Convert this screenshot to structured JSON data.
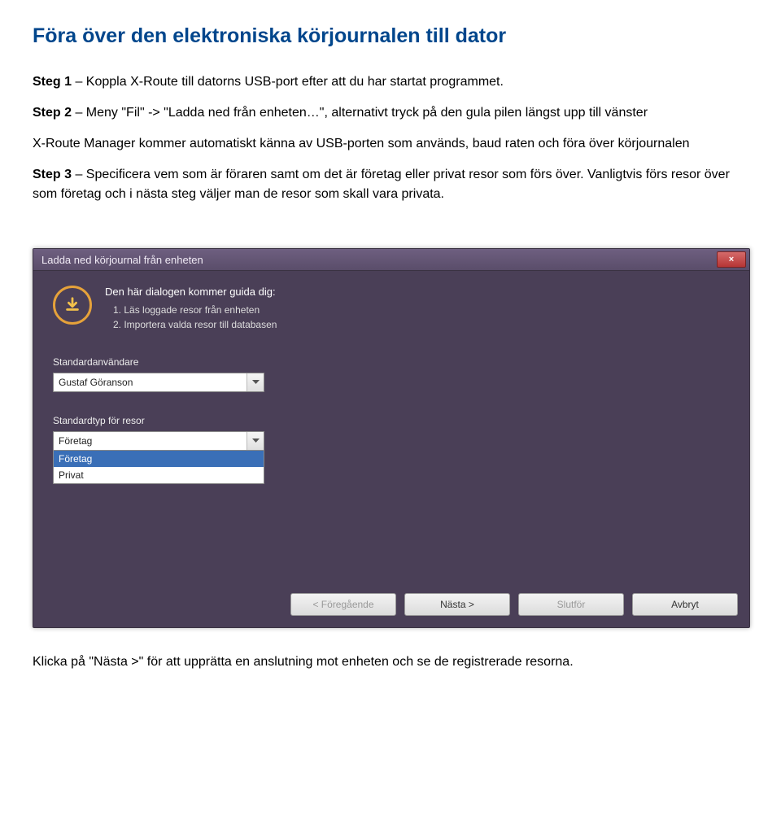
{
  "title": "Föra över den elektroniska körjournalen till dator",
  "step1_label": "Steg 1",
  "step1_text": " – Koppla X-Route till datorns USB-port efter att du har startat programmet.",
  "step2_label": "Step 2",
  "step2_text": " – Meny \"Fil\" -> \"Ladda ned från enheten…\", alternativt tryck på den gula pilen längst upp till vänster",
  "para2": "X-Route Manager kommer automatiskt känna av USB-porten som används, baud raten och föra över körjournalen",
  "step3_label": "Step 3",
  "step3_text": " – Specificera vem som är föraren samt om det är företag eller privat resor som förs över. Vanligtvis förs resor över som företag och i nästa steg väljer man de resor som skall vara privata.",
  "dialog": {
    "title": "Ladda ned körjournal från enheten",
    "close": "×",
    "guide_header": "Den här dialogen kommer guida dig:",
    "guide_line1": "1. Läs loggade resor från enheten",
    "guide_line2": "2. Importera valda resor till databasen",
    "user_label": "Standardanvändare",
    "user_value": "Gustaf Göranson",
    "type_label": "Standardtyp för resor",
    "type_value": "Företag",
    "type_options": [
      "Företag",
      "Privat"
    ],
    "buttons": {
      "prev": "< Föregående",
      "next": "Nästa >",
      "finish": "Slutför",
      "cancel": "Avbryt"
    }
  },
  "footer_text": "Klicka på \"Nästa >\" för att upprätta en anslutning mot enheten och se de registrerade resorna."
}
